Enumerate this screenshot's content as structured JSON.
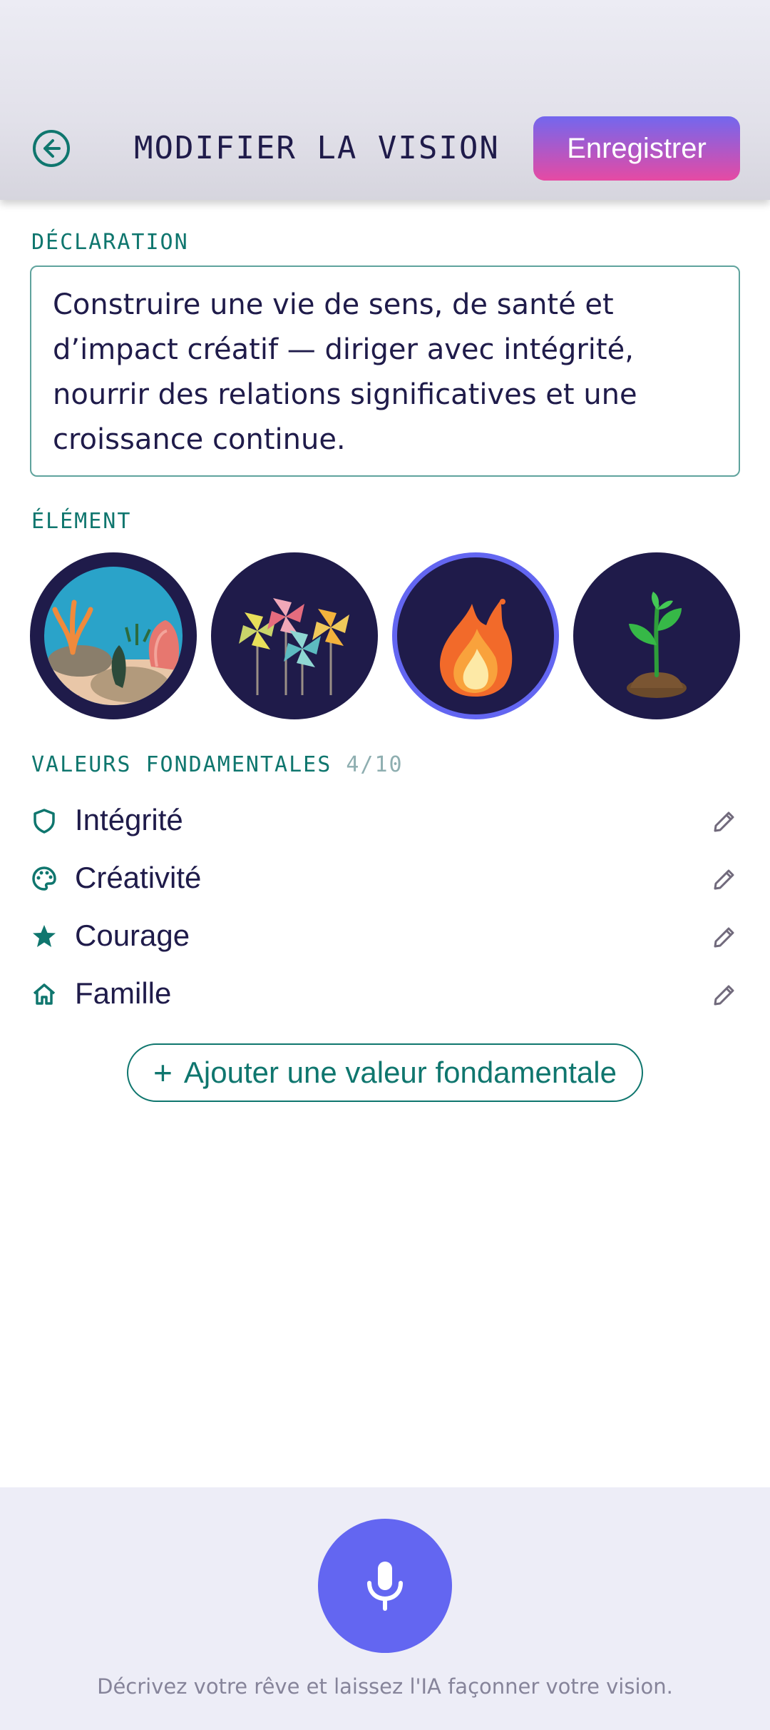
{
  "header": {
    "title": "MODIFIER LA VISION",
    "save_label": "Enregistrer",
    "back_icon": "arrow-left-circle-icon"
  },
  "declaration": {
    "label": "DÉCLARATION",
    "text": "Construire une vie de sens, de santé et d’impact créatif — diriger avec intégrité, nourrir des relations significatives et une croissance continue."
  },
  "element": {
    "label": "ÉLÉMENT",
    "options": [
      {
        "name": "water",
        "icon": "coral-reef-icon",
        "selected": false
      },
      {
        "name": "air",
        "icon": "pinwheels-icon",
        "selected": false
      },
      {
        "name": "fire",
        "icon": "flame-icon",
        "selected": true
      },
      {
        "name": "earth",
        "icon": "sprout-icon",
        "selected": false
      }
    ]
  },
  "values": {
    "label": "VALEURS FONDAMENTALES",
    "count": "4/10",
    "items": [
      {
        "label": "Intégrité",
        "icon": "shield-icon"
      },
      {
        "label": "Créativité",
        "icon": "palette-icon"
      },
      {
        "label": "Courage",
        "icon": "star-icon"
      },
      {
        "label": "Famille",
        "icon": "home-icon"
      }
    ],
    "add_label": "Ajouter une valeur fondamentale"
  },
  "voice": {
    "icon": "microphone-icon",
    "hint": "Décrivez votre rêve et laissez l'IA façonner votre vision."
  },
  "colors": {
    "accent": "#6366f1",
    "teal": "#0f766e",
    "navy": "#1f1b4a",
    "save_gradient_top": "#7367ee",
    "save_gradient_bottom": "#e64aa3"
  }
}
